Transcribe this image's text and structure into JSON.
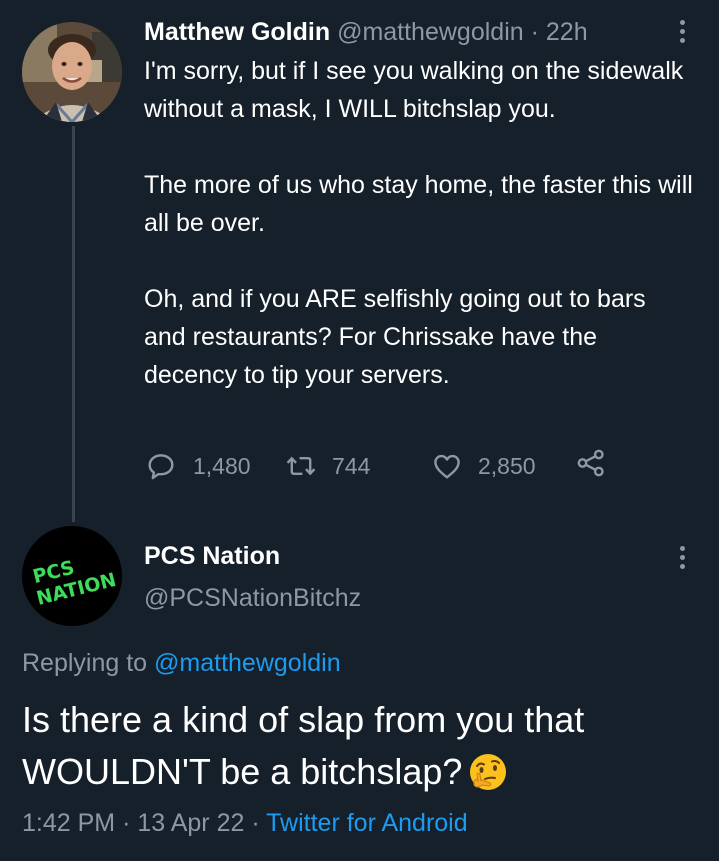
{
  "original_tweet": {
    "author_name": "Matthew Goldin",
    "author_handle": "@matthewgoldin",
    "separator": "·",
    "time_ago": "22h",
    "paragraphs": [
      "I'm sorry, but if I see you walking on the sidewalk without a mask, I WILL bitchslap you.",
      "The more of us who stay home, the faster this will all be over.",
      "Oh, and if you ARE selfishly going out to bars and restaurants? For Chrissake have the decency to tip your servers."
    ],
    "actions": {
      "reply_icon": "speech-bubble-icon",
      "reply_count": "1,480",
      "retweet_icon": "retweet-icon",
      "retweet_count": "744",
      "like_icon": "heart-icon",
      "like_count": "2,850",
      "share_icon": "share-icon"
    }
  },
  "reply_tweet": {
    "author_name": "PCS Nation",
    "author_handle": "@PCSNationBitchz",
    "avatar_logo_text": "PCS NATION",
    "replying_prefix": "Replying to",
    "replying_to": "@matthewgoldin",
    "text": "Is there a kind of slap from you that WOULDN'T be a bitchslap?",
    "emoji": "thinking-face-emoji",
    "time": "1:42 PM",
    "separator": "·",
    "date": "13 Apr 22",
    "client": "Twitter for Android"
  },
  "colors": {
    "background": "#15202b",
    "text": "#ffffff",
    "muted": "#8b98a5",
    "link": "#1d9bf0",
    "thread_line": "#38444d",
    "logo_green": "#3ddc5b"
  },
  "icons": [
    "more-icon",
    "speech-bubble-icon",
    "retweet-icon",
    "heart-icon",
    "share-icon",
    "thinking-face-emoji"
  ]
}
